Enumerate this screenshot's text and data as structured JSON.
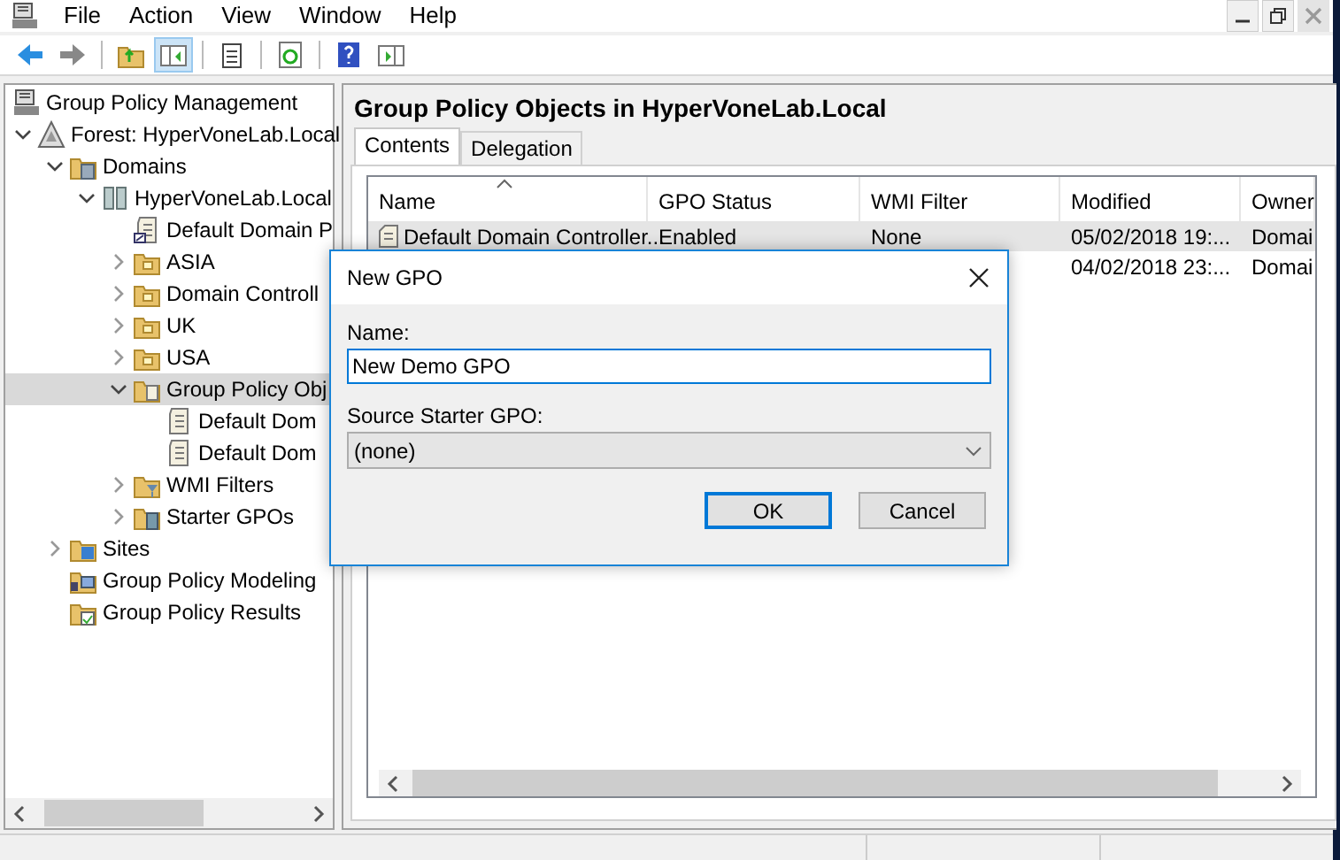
{
  "menu": [
    "File",
    "Action",
    "View",
    "Window",
    "Help"
  ],
  "toolbar": [
    {
      "pressed": false
    },
    {
      "pressed": false
    },
    {
      "pressed": false
    },
    {
      "pressed": true
    },
    {
      "pressed": false
    },
    {
      "pressed": false
    },
    {
      "pressed": false
    },
    {
      "pressed": false
    }
  ],
  "tree": [
    {
      "label": "Group Policy Management",
      "kind": "console",
      "selected": false,
      "children": [
        {
          "label": "Forest: HyperVoneLab.Local",
          "kind": "forest",
          "expanded": true,
          "selected": false,
          "children": [
            {
              "label": "Domains",
              "kind": "domains",
              "expanded": true,
              "selected": false,
              "children": [
                {
                  "label": "HyperVoneLab.Local",
                  "kind": "domain",
                  "expanded": true,
                  "selected": false,
                  "children": [
                    {
                      "label": "Default Domain P",
                      "kind": "link",
                      "selected": false
                    },
                    {
                      "label": "ASIA",
                      "kind": "ou",
                      "expanded": false,
                      "selected": false
                    },
                    {
                      "label": "Domain Controll",
                      "kind": "ou",
                      "expanded": false,
                      "selected": false
                    },
                    {
                      "label": "UK",
                      "kind": "ou",
                      "expanded": false,
                      "selected": false
                    },
                    {
                      "label": "USA",
                      "kind": "ou",
                      "expanded": false,
                      "selected": false
                    },
                    {
                      "label": "Group Policy Obj",
                      "kind": "gpofolder",
                      "expanded": true,
                      "selected": true,
                      "children": [
                        {
                          "label": "Default Dom",
                          "kind": "gpo",
                          "selected": false
                        },
                        {
                          "label": "Default Dom",
                          "kind": "gpo",
                          "selected": false
                        }
                      ]
                    },
                    {
                      "label": "WMI Filters",
                      "kind": "wmi",
                      "expanded": false,
                      "selected": false
                    },
                    {
                      "label": "Starter GPOs",
                      "kind": "starter",
                      "expanded": false,
                      "selected": false
                    }
                  ]
                }
              ]
            },
            {
              "label": "Sites",
              "kind": "sites",
              "expanded": false,
              "selected": false
            },
            {
              "label": "Group Policy Modeling",
              "kind": "modeling",
              "selected": false
            },
            {
              "label": "Group Policy Results",
              "kind": "results",
              "selected": false
            }
          ]
        }
      ]
    }
  ],
  "pane": {
    "title": "Group Policy Objects in HyperVoneLab.Local",
    "tabs": [
      {
        "label": "Contents",
        "selected": true
      },
      {
        "label": "Delegation",
        "selected": false
      }
    ],
    "table": {
      "columns": [
        "Name",
        "GPO Status",
        "WMI Filter",
        "Modified",
        "Owner"
      ],
      "rows": [
        {
          "selected": true,
          "name": "Default Domain Controller...",
          "status": "Enabled",
          "wmi": "None",
          "modified": "05/02/2018 19:...",
          "owner": "Domai"
        },
        {
          "selected": false,
          "modified": "04/02/2018 23:...",
          "owner": "Domai"
        }
      ]
    }
  },
  "dialog": {
    "title": "New GPO",
    "name_label": "Name:",
    "name_value": "New Demo GPO",
    "source_label": "Source Starter GPO:",
    "source_value": "(none)",
    "buttons": [
      {
        "label": "OK",
        "default": true
      },
      {
        "label": "Cancel",
        "default": false
      }
    ]
  }
}
